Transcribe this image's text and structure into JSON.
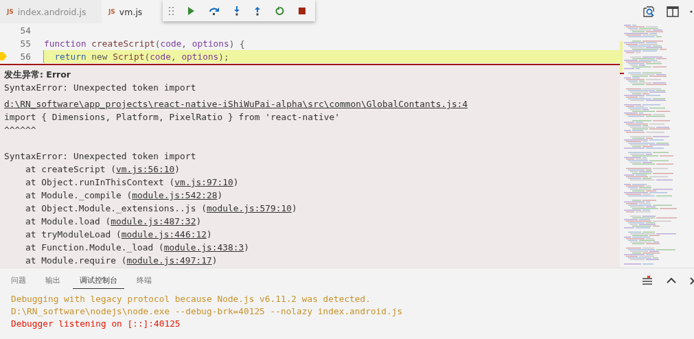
{
  "tabs": [
    {
      "icon_text": "JS",
      "label": "index.android.js",
      "selected": false
    },
    {
      "icon_text": "JS",
      "label": "vm.js",
      "selected": true
    }
  ],
  "debug_toolbar": {
    "buttons": [
      {
        "kind": "continue"
      },
      {
        "kind": "step-over"
      },
      {
        "kind": "step-into"
      },
      {
        "kind": "step-out"
      },
      {
        "kind": "restart"
      },
      {
        "kind": "stop"
      }
    ]
  },
  "editor": {
    "lines": [
      {
        "number": "54",
        "current": false
      },
      {
        "number": "55",
        "current": false,
        "tokens": [
          {
            "text": "function ",
            "kind": "keyword"
          },
          {
            "text": "createScript",
            "kind": "function"
          },
          {
            "text": "(",
            "kind": "plain"
          },
          {
            "text": "code",
            "kind": "param"
          },
          {
            "text": ", ",
            "kind": "plain"
          },
          {
            "text": "options",
            "kind": "param"
          },
          {
            "text": ") {",
            "kind": "plain"
          }
        ]
      },
      {
        "number": "56",
        "current": true,
        "tokens": [
          {
            "text": "  return",
            "kind": "control"
          },
          {
            "text": " new ",
            "kind": "plain"
          },
          {
            "text": "Script",
            "kind": "function"
          },
          {
            "text": "(",
            "kind": "plain"
          },
          {
            "text": "code",
            "kind": "param"
          },
          {
            "text": ", ",
            "kind": "plain"
          },
          {
            "text": "options",
            "kind": "param"
          },
          {
            "text": ");",
            "kind": "plain"
          }
        ]
      }
    ]
  },
  "exception": {
    "title": "发生异常: Error",
    "message": "SyntaxError: Unexpected token import",
    "source_link": "d:\\RN_software\\app_projects\\react-native-iShiWuPai-alpha\\src\\common\\GlobalContants.js:4",
    "source_line": "import { Dimensions, Platform, PixelRatio } from 'react-native'",
    "caret_line": "^^^^^^",
    "stack_title": "SyntaxError: Unexpected token import",
    "stack": [
      {
        "before": "    at createScript (",
        "link": "vm.js:56:10",
        "after": ")"
      },
      {
        "before": "    at Object.runInThisContext (",
        "link": "vm.js:97:10",
        "after": ")"
      },
      {
        "before": "    at Module._compile (",
        "link": "module.js:542:28",
        "after": ")"
      },
      {
        "before": "    at Object.Module._extensions..js (",
        "link": "module.js:579:10",
        "after": ")"
      },
      {
        "before": "    at Module.load (",
        "link": "module.js:487:32",
        "after": ")"
      },
      {
        "before": "    at tryModuleLoad (",
        "link": "module.js:446:12",
        "after": ")"
      },
      {
        "before": "    at Function.Module._load (",
        "link": "module.js:438:3",
        "after": ")"
      },
      {
        "before": "    at Module.require (",
        "link": "module.js:497:17",
        "after": ")"
      }
    ]
  },
  "panel": {
    "tabs": [
      {
        "label": "问题",
        "selected": false
      },
      {
        "label": "输出",
        "selected": false
      },
      {
        "label": "调试控制台",
        "selected": true
      },
      {
        "label": "终端",
        "selected": false
      }
    ],
    "console": [
      {
        "text": "Debugging with legacy protocol because Node.js v6.11.2 was detected.",
        "kind": "warning"
      },
      {
        "text": "D:\\RN_software\\nodejs\\node.exe --debug-brk=40125 --nolazy index.android.js",
        "kind": "warning"
      },
      {
        "text": "Debugger listening on [::]:40125",
        "kind": "error"
      }
    ]
  }
}
